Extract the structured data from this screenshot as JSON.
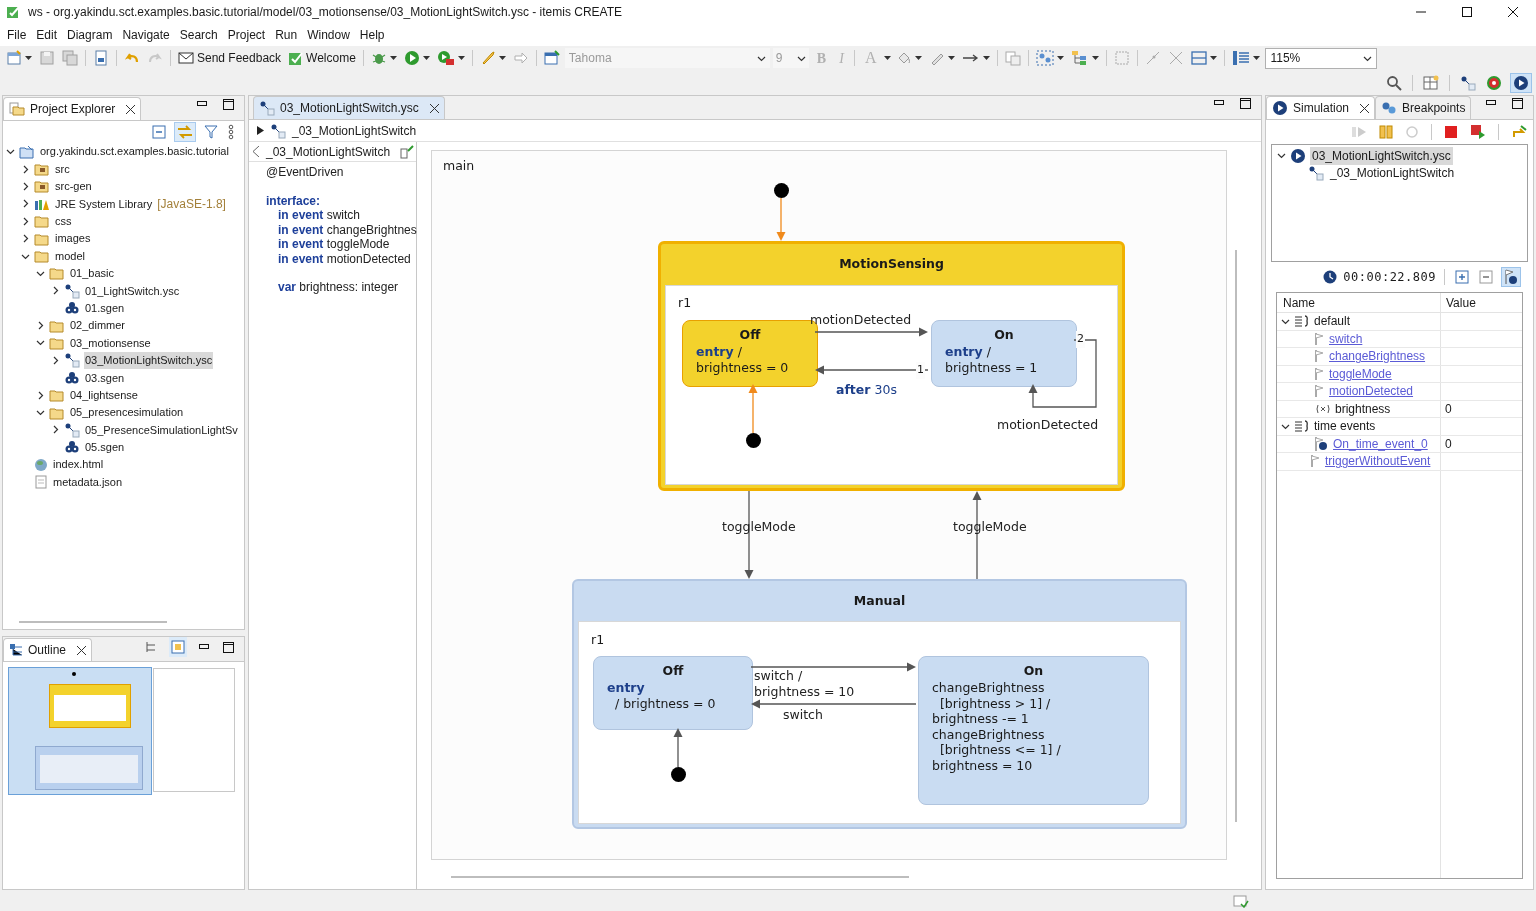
{
  "window": {
    "title": "ws - org.yakindu.sct.examples.basic.tutorial/model/03_motionsense/03_MotionLightSwitch.ysc - itemis CREATE"
  },
  "menu": [
    "File",
    "Edit",
    "Diagram",
    "Navigate",
    "Search",
    "Project",
    "Run",
    "Window",
    "Help"
  ],
  "toolbar": {
    "buttons": [
      "Send Feedback",
      "Welcome"
    ],
    "font": "Tahoma",
    "font_size": "9",
    "format_buttons": [
      {
        "label": "B",
        "disabled": true
      },
      {
        "label": "I",
        "disabled": true
      },
      {
        "label": "A",
        "disabled": true
      }
    ],
    "zoom": "115%"
  },
  "project_explorer": {
    "title": "Project Explorer",
    "tree": [
      {
        "label": "org.yakindu.sct.examples.basic.tutorial",
        "kind": "project",
        "expanded": true,
        "selected": false,
        "children": [
          {
            "label": "src",
            "kind": "source-folder",
            "expanded": false,
            "selected": false
          },
          {
            "label": "src-gen",
            "kind": "source-folder",
            "expanded": false,
            "selected": false
          },
          {
            "label": "JRE System Library",
            "decoration": "[JavaSE-1.8]",
            "kind": "library",
            "expanded": false,
            "selected": false
          },
          {
            "label": "css",
            "kind": "folder",
            "expanded": false,
            "selected": false
          },
          {
            "label": "images",
            "kind": "folder",
            "expanded": false,
            "selected": false
          },
          {
            "label": "model",
            "kind": "folder",
            "expanded": true,
            "selected": false,
            "children": [
              {
                "label": "01_basic",
                "kind": "folder",
                "expanded": true,
                "selected": false,
                "children": [
                  {
                    "label": "01_LightSwitch.ysc",
                    "kind": "statechart",
                    "expanded": false,
                    "selected": false
                  },
                  {
                    "label": "01.sgen",
                    "kind": "sgen",
                    "selected": false
                  }
                ]
              },
              {
                "label": "02_dimmer",
                "kind": "folder",
                "expanded": false,
                "selected": false
              },
              {
                "label": "03_motionsense",
                "kind": "folder",
                "expanded": true,
                "selected": false,
                "children": [
                  {
                    "label": "03_MotionLightSwitch.ysc",
                    "kind": "statechart",
                    "expanded": false,
                    "selected": true
                  },
                  {
                    "label": "03.sgen",
                    "kind": "sgen",
                    "selected": false
                  }
                ]
              },
              {
                "label": "04_lightsense",
                "kind": "folder",
                "expanded": false,
                "selected": false
              },
              {
                "label": "05_presencesimulation",
                "kind": "folder",
                "expanded": true,
                "selected": false,
                "children": [
                  {
                    "label": "05_PresenceSimulationLightSv",
                    "kind": "statechart",
                    "expanded": false,
                    "selected": false
                  },
                  {
                    "label": "05.sgen",
                    "kind": "sgen",
                    "selected": false
                  }
                ]
              }
            ]
          },
          {
            "label": "index.html",
            "kind": "html",
            "selected": false
          },
          {
            "label": "metadata.json",
            "kind": "file",
            "selected": false
          }
        ]
      }
    ]
  },
  "outline": {
    "title": "Outline"
  },
  "editor": {
    "tab": "03_MotionLightSwitch.ysc",
    "breadcrumb": "_03_MotionLightSwitch",
    "definition": {
      "title": "_03_MotionLightSwitch",
      "blocks": [
        {
          "lines": [
            {
              "text": "@EventDriven",
              "kind": "annotation"
            }
          ]
        },
        {
          "lines": [
            {
              "text": "interface:",
              "kind": "heading"
            },
            {
              "text": "**in event** switch",
              "kind": "member"
            },
            {
              "text": "**in event** changeBrightnes",
              "kind": "member"
            },
            {
              "text": "**in event** toggleMode",
              "kind": "member"
            },
            {
              "text": "**in event** motionDetected",
              "kind": "member"
            }
          ]
        },
        {
          "lines": [
            {
              "text": "**var** brightness: integer",
              "kind": "member"
            }
          ]
        }
      ]
    },
    "diagram": {
      "label": "main",
      "states": [
        {
          "name": "MotionSensing",
          "active": true,
          "region": "r1",
          "children": [
            {
              "name": "Off",
              "active": true,
              "lines": [
                "**entry** /",
                "brightness = 0"
              ]
            },
            {
              "name": "On",
              "active": false,
              "lines": [
                "**entry** /",
                "brightness = 1"
              ]
            }
          ]
        },
        {
          "name": "Manual",
          "active": false,
          "region": "r1",
          "children": [
            {
              "name": "Off",
              "active": false,
              "lines": [
                "**entry**",
                "  / brightness = 0"
              ]
            },
            {
              "name": "On",
              "active": false,
              "lines": [
                "changeBrightness",
                "  [brightness > 1] /",
                "brightness -= 1",
                "changeBrightness",
                "  [brightness <= 1] /",
                "brightness = 10"
              ]
            }
          ]
        }
      ],
      "transitions": [
        {
          "kind": "initial",
          "active": true
        },
        {
          "kind": "event",
          "label": "motionDetected",
          "active": false
        },
        {
          "kind": "time",
          "label": "**after** 30s",
          "priority": "1",
          "active": false
        },
        {
          "kind": "event",
          "label": "motionDetected",
          "priority": "2",
          "active": false
        },
        {
          "kind": "initial",
          "active": true
        },
        {
          "kind": "event",
          "label": "toggleMode",
          "active": false
        },
        {
          "kind": "event",
          "label": "toggleMode",
          "active": false
        },
        {
          "kind": "event",
          "label": "switch /\nbrightness = 10",
          "active": false
        },
        {
          "kind": "event",
          "label": "switch",
          "active": false
        },
        {
          "kind": "initial",
          "active": false
        }
      ]
    }
  },
  "simulation": {
    "tabs": [
      {
        "label": "Simulation",
        "selected": true
      },
      {
        "label": "Breakpoints",
        "selected": false
      }
    ],
    "sessions": [
      {
        "label": "03_MotionLightSwitch.ysc",
        "selected": true,
        "children": [
          {
            "label": "_03_MotionLightSwitch",
            "selected": false
          }
        ]
      }
    ],
    "clock": "00:00:22.809",
    "columns": [
      "Name",
      "Value"
    ],
    "rows": [
      {
        "name": "default",
        "kind": "scope",
        "expanded": true,
        "children": [
          {
            "name": "switch",
            "kind": "event"
          },
          {
            "name": "changeBrightness",
            "kind": "event"
          },
          {
            "name": "toggleMode",
            "kind": "event"
          },
          {
            "name": "motionDetected",
            "kind": "event"
          },
          {
            "name": "brightness",
            "kind": "variable",
            "value": "0"
          }
        ]
      },
      {
        "name": "time events",
        "kind": "scope",
        "expanded": true,
        "children": [
          {
            "name": "On_time_event_0",
            "kind": "time-event",
            "value": "0"
          }
        ]
      },
      {
        "name": "triggerWithoutEvent",
        "kind": "event"
      }
    ]
  }
}
